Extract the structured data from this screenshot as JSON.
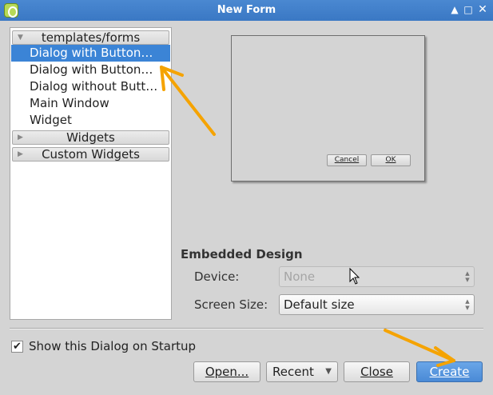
{
  "window": {
    "title": "New Form",
    "controls": {
      "up": "▲",
      "minimize": "□",
      "close": "✕"
    }
  },
  "tree": {
    "categories": [
      {
        "label": "templates/forms",
        "expanded": true,
        "arrow": "▼"
      },
      {
        "label": "Widgets",
        "expanded": false,
        "arrow": "▶"
      },
      {
        "label": "Custom Widgets",
        "expanded": false,
        "arrow": "▶"
      }
    ],
    "templates": [
      "Dialog with Button…",
      "Dialog with Button…",
      "Dialog without Butt…",
      "Main Window",
      "Widget"
    ],
    "selected_index": 0
  },
  "preview": {
    "cancel_label": "Cancel",
    "ok_label": "OK"
  },
  "embedded": {
    "title": "Embedded Design",
    "device_label": "Device:",
    "device_value": "None",
    "screen_size_label": "Screen Size:",
    "screen_size_value": "Default size"
  },
  "footer": {
    "show_on_startup_label": "Show this Dialog on Startup",
    "show_on_startup_checked": true,
    "open_label": "Open...",
    "recent_label": "Recent",
    "close_label": "Close",
    "create_label": "Create"
  },
  "colors": {
    "accent": "#3b84d6",
    "annotation_arrow": "#f5a300"
  },
  "icons": {
    "check": "✔",
    "caret": "▼",
    "spin": "⬍"
  }
}
